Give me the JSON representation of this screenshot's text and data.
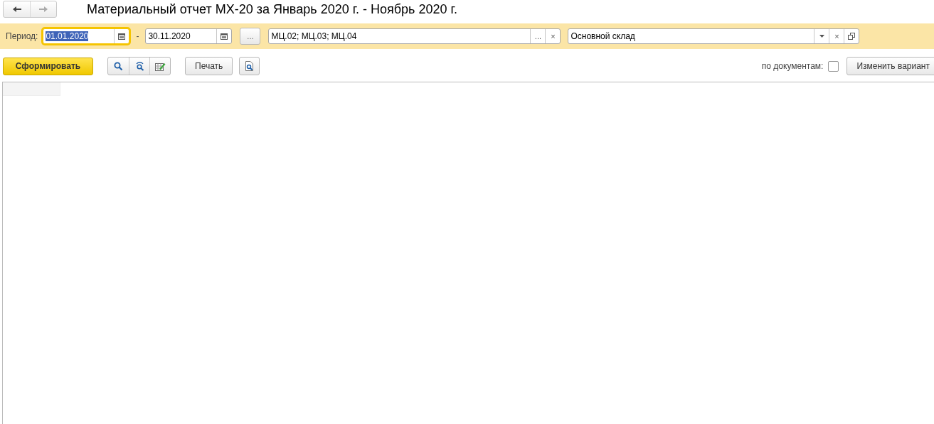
{
  "title": "Материальный отчет МХ-20 за Январь 2020 г. - Ноябрь 2020 г.",
  "nav": [
    {
      "kind": "back",
      "disabled": false
    },
    {
      "kind": "forward",
      "disabled": true
    }
  ],
  "filters": {
    "period_label": "Период:",
    "date_from": {
      "value": "01.01.2020",
      "focused": true
    },
    "separator": "-",
    "date_to": {
      "value": "30.11.2020",
      "focused": false
    },
    "period_button": "...",
    "warehouses_field": {
      "value": "МЦ.02; МЦ.03; МЦ.04",
      "select_button": "...",
      "clear_button": "×"
    },
    "storage_field": {
      "value": "Основной склад",
      "clear_button": "×"
    }
  },
  "toolbar": {
    "generate_button": "Сформировать",
    "print_button": "Печать",
    "by_documents_label": "по документам:",
    "by_documents_checked": false,
    "change_variant_button": "Изменить вариант"
  }
}
